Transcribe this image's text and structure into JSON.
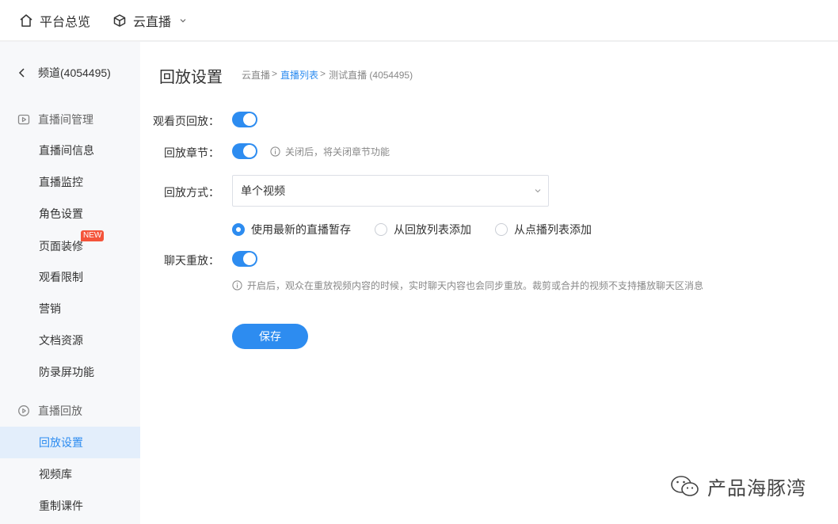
{
  "topbar": {
    "home_label": "平台总览",
    "product_label": "云直播"
  },
  "sidebar": {
    "back_label": "频道(4054495)",
    "group1_label": "直播间管理",
    "group1_items": [
      {
        "label": "直播间信息"
      },
      {
        "label": "直播监控"
      },
      {
        "label": "角色设置"
      },
      {
        "label": "页面装修",
        "badge": "NEW"
      },
      {
        "label": "观看限制"
      },
      {
        "label": "营销"
      },
      {
        "label": "文档资源"
      },
      {
        "label": "防录屏功能"
      }
    ],
    "group2_label": "直播回放",
    "group2_items": [
      {
        "label": "回放设置",
        "active": true
      },
      {
        "label": "视频库"
      },
      {
        "label": "重制课件"
      }
    ]
  },
  "main": {
    "title": "回放设置",
    "breadcrumb": {
      "item1": "云直播",
      "item2": "直播列表",
      "item3": "测试直播 (4054495)",
      "sep": ">"
    },
    "form": {
      "watch_replay_label": "观看页回放：",
      "watch_replay_on": true,
      "chapter_label": "回放章节：",
      "chapter_on": true,
      "chapter_hint": "关闭后，将关闭章节功能",
      "mode_label": "回放方式：",
      "mode_value": "单个视频",
      "source_options": [
        {
          "label": "使用最新的直播暂存",
          "checked": true
        },
        {
          "label": "从回放列表添加",
          "checked": false
        },
        {
          "label": "从点播列表添加",
          "checked": false
        }
      ],
      "chat_replay_label": "聊天重放：",
      "chat_replay_on": true,
      "chat_hint": "开启后，观众在重放视频内容的时候，实时聊天内容也会同步重放。裁剪或合并的视频不支持播放聊天区消息",
      "save_label": "保存"
    }
  },
  "watermark": {
    "text": "产品海豚湾"
  },
  "colors": {
    "accent": "#2d8cf0",
    "badge": "#f4543a",
    "sidebar_bg": "#f7f8fa",
    "active_bg": "#e3eefb"
  }
}
